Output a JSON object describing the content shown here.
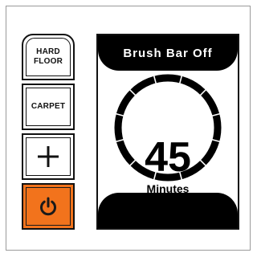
{
  "buttons": {
    "hard_floor": {
      "line1": "HARD",
      "line2": "FLOOR"
    },
    "carpet": "CARPET",
    "plus": "+",
    "power_icon": "power-icon"
  },
  "display": {
    "status": "Brush Bar Off",
    "time_value": "45",
    "time_unit": "Minutes"
  },
  "colors": {
    "power_button": "#f2731c",
    "display_bars": "#000000"
  }
}
